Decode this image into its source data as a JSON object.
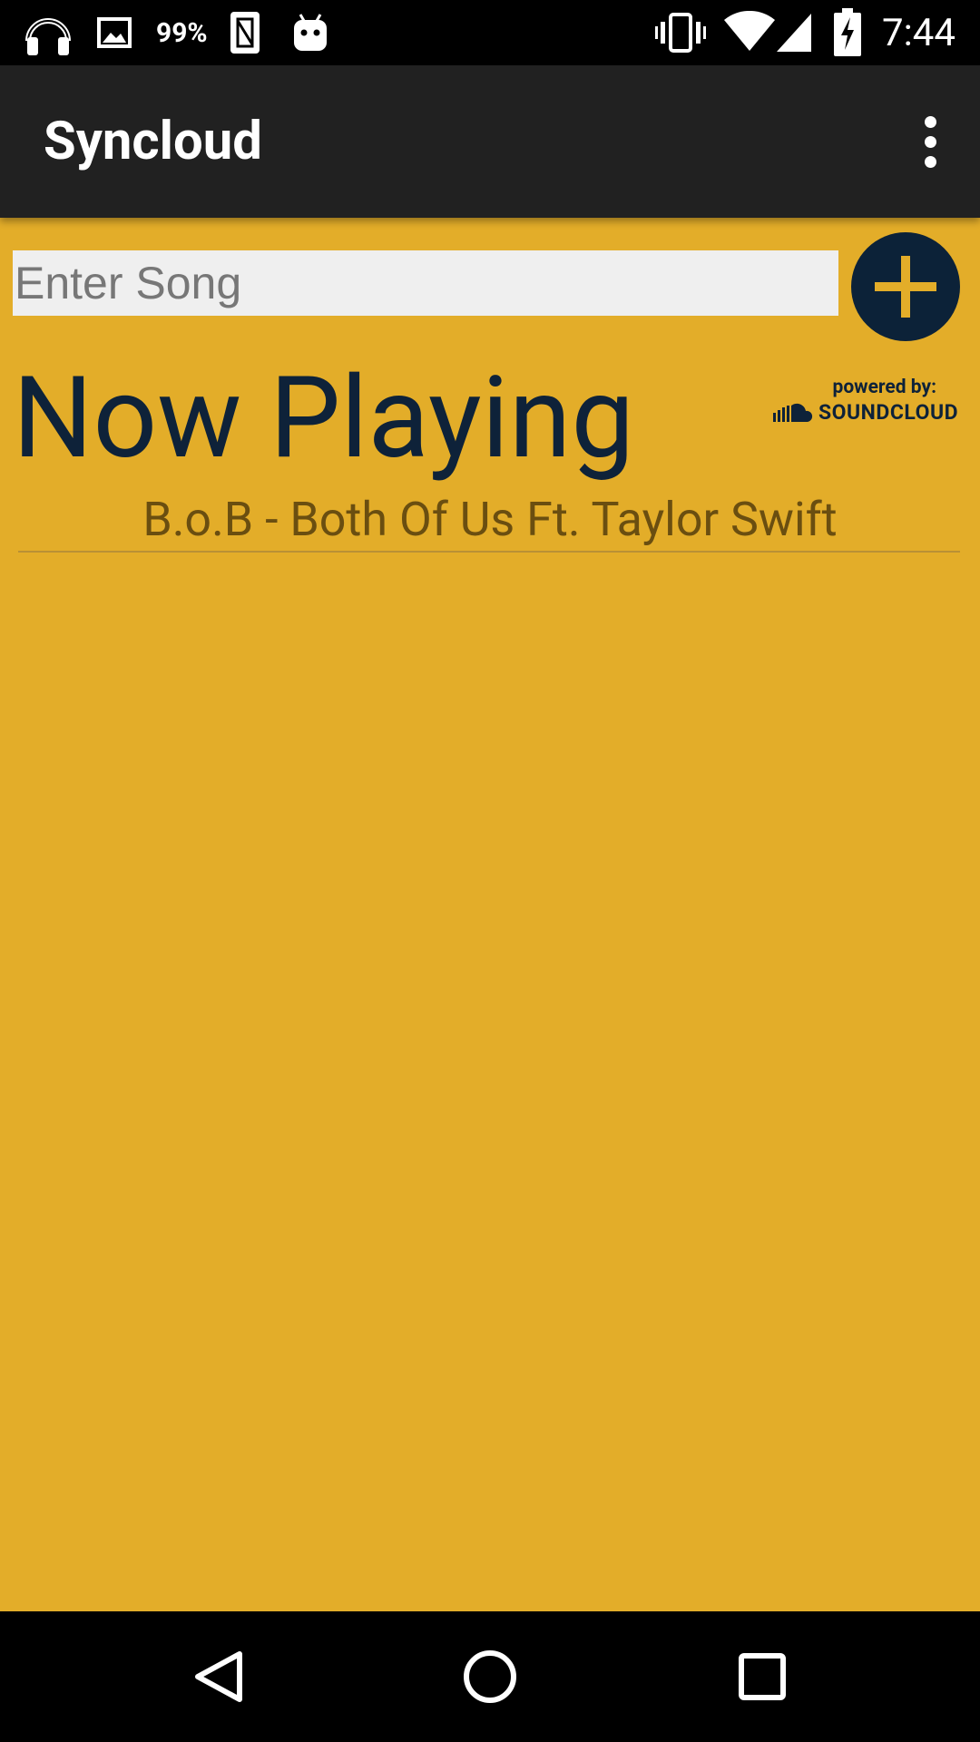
{
  "status_bar": {
    "battery_percent_text": "99%",
    "time": "7:44",
    "icons_left": [
      "headphones-icon",
      "image-icon",
      "sim-icon",
      "android-icon"
    ],
    "icons_right": [
      "vibrate-icon",
      "wifi-icon",
      "cell-signal-icon",
      "battery-charging-icon"
    ]
  },
  "app_bar": {
    "title": "Syncloud",
    "menu_icon": "more-vert-icon"
  },
  "search": {
    "placeholder": "Enter Song",
    "value": ""
  },
  "add_button": {
    "icon": "plus-icon"
  },
  "main": {
    "heading": "Now Playing",
    "powered_by": "powered by:",
    "soundcloud_label": "SOUNDCLOUD",
    "track": "B.o.B - Both Of Us Ft. Taylor Swift"
  },
  "nav_bar": {
    "back_icon": "back-triangle-icon",
    "home_icon": "home-circle-icon",
    "recents_icon": "recents-square-icon"
  },
  "colors": {
    "background": "#E3AD29",
    "app_bar": "#212121",
    "navy": "#0E2239",
    "track_text": "#6A4E10"
  }
}
